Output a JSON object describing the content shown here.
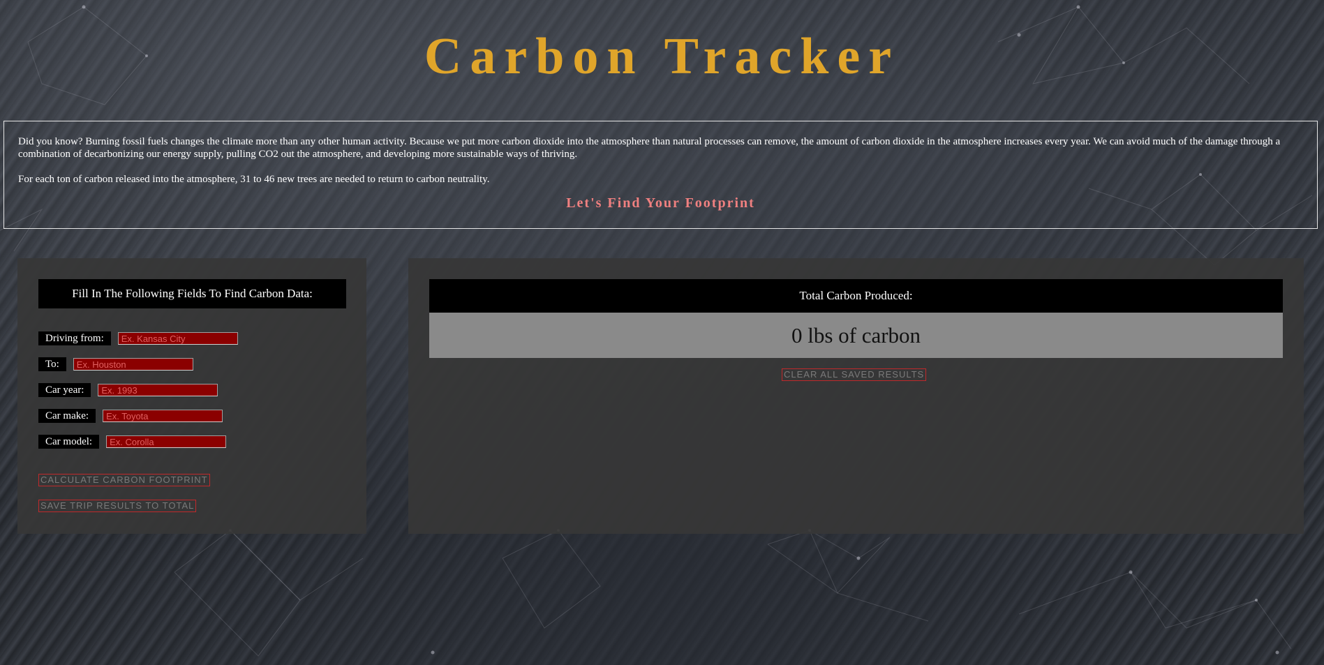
{
  "header": {
    "title": "Carbon Tracker"
  },
  "intro": {
    "paragraph1": "Did you know? Burning fossil fuels changes the climate more than any other human activity. Because we put more carbon dioxide into the atmosphere than natural processes can remove, the amount of carbon dioxide in the atmosphere increases every year. We can avoid much of the damage through a combination of decarbonizing our energy supply, pulling CO2 out the atmosphere, and developing more sustainable ways of thriving.",
    "paragraph2": "For each ton of carbon released into the atmosphere, 31 to 46 new trees are needed to return to carbon neutrality.",
    "cta": "Let's Find Your Footprint"
  },
  "form": {
    "heading": "Fill In The Following Fields To Find Carbon Data:",
    "fields": [
      {
        "label": "Driving from:",
        "placeholder": "Ex. Kansas City",
        "value": ""
      },
      {
        "label": "To:",
        "placeholder": "Ex. Houston",
        "value": ""
      },
      {
        "label": "Car year:",
        "placeholder": "Ex. 1993",
        "value": ""
      },
      {
        "label": "Car make:",
        "placeholder": "Ex. Toyota",
        "value": ""
      },
      {
        "label": "Car model:",
        "placeholder": "Ex. Corolla",
        "value": ""
      }
    ],
    "calculate_label": "CALCULATE CARBON FOOTPRINT",
    "save_label": "SAVE TRIP RESULTS TO TOTAL"
  },
  "results": {
    "heading": "Total Carbon Produced:",
    "total": "0 lbs of carbon",
    "clear_label": "CLEAR ALL SAVED RESULTS"
  },
  "colors": {
    "title": "#e0a52a",
    "cta": "#f08080",
    "input_bg": "#8b0000",
    "button_border": "#c0292b"
  }
}
